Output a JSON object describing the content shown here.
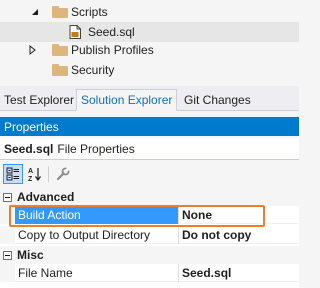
{
  "solution_tree": {
    "items": [
      {
        "label": "Scripts",
        "icon": "folder-icon",
        "expanded": true
      },
      {
        "label": "Seed.sql",
        "icon": "sql-file-icon",
        "selected": true
      },
      {
        "label": "Publish Profiles",
        "icon": "folder-icon",
        "expanded": false
      },
      {
        "label": "Security",
        "icon": "folder-icon"
      }
    ]
  },
  "tabs": [
    {
      "label": "Test Explorer",
      "active": false
    },
    {
      "label": "Solution Explorer",
      "active": true
    },
    {
      "label": "Git Changes",
      "active": false
    }
  ],
  "properties": {
    "title": "Properties",
    "object_name": "Seed.sql",
    "object_type": "File Properties",
    "toolbar": {
      "categorized_icon": "categorized-icon",
      "alphabetical_icon": "alphabetical-sort-icon",
      "property_pages_icon": "wrench-icon"
    },
    "categories": [
      {
        "label": "Advanced",
        "rows": [
          {
            "name": "Build Action",
            "value": "None",
            "selected": true
          },
          {
            "name": "Copy to Output Directory",
            "value": "Do not copy"
          }
        ]
      },
      {
        "label": "Misc",
        "rows": [
          {
            "name": "File Name",
            "value": "Seed.sql"
          }
        ]
      }
    ]
  },
  "colors": {
    "accent": "#007acc",
    "selection": "#3399ff",
    "highlight_annotation": "#ed7d31",
    "folder": "#dcb67a"
  }
}
